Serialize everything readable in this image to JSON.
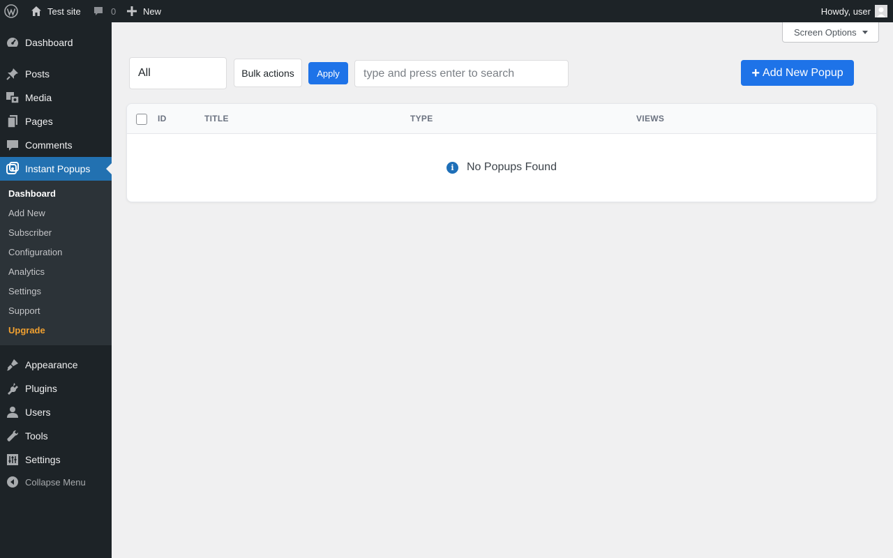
{
  "admin_bar": {
    "site_name": "Test site",
    "comments_count": "0",
    "new_label": "New",
    "howdy": "Howdy, user"
  },
  "sidebar": {
    "items": [
      {
        "label": "Dashboard",
        "icon": "dashboard-icon"
      },
      {
        "label": "Posts",
        "icon": "pushpin-icon"
      },
      {
        "label": "Media",
        "icon": "media-icon"
      },
      {
        "label": "Pages",
        "icon": "pages-icon"
      },
      {
        "label": "Comments",
        "icon": "comment-icon"
      },
      {
        "label": "Instant Popups",
        "icon": "instant-popups-icon",
        "active": true
      },
      {
        "label": "Appearance",
        "icon": "brush-icon"
      },
      {
        "label": "Plugins",
        "icon": "plug-icon"
      },
      {
        "label": "Users",
        "icon": "user-icon"
      },
      {
        "label": "Tools",
        "icon": "wrench-icon"
      },
      {
        "label": "Settings",
        "icon": "settings-icon"
      }
    ],
    "submenu": [
      "Dashboard",
      "Add New",
      "Subscriber",
      "Configuration",
      "Analytics",
      "Settings",
      "Support",
      "Upgrade"
    ],
    "collapse_label": "Collapse Menu"
  },
  "screen_options": {
    "label": "Screen Options"
  },
  "toolbar": {
    "filter_value": "All",
    "bulk_actions_label": "Bulk actions",
    "apply_label": "Apply",
    "search_placeholder": "type and press enter to search",
    "add_new_label": "Add New Popup"
  },
  "table": {
    "columns": [
      "ID",
      "TITLE",
      "TYPE",
      "VIEWS"
    ],
    "empty_message": "No Popups Found"
  },
  "colors": {
    "admin_dark": "#1d2327",
    "submenu_bg": "#2c3338",
    "active_blue": "#2271b1",
    "primary_button": "#1e73e8",
    "upgrade_orange": "#f0a030"
  }
}
